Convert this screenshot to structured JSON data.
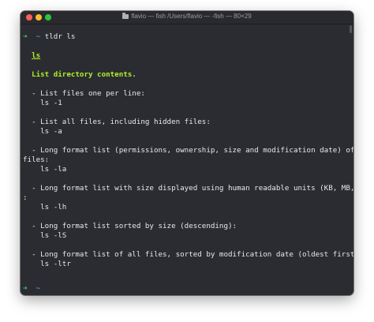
{
  "window": {
    "title": "flavio — fish /Users/flavio — -fish — 80×29"
  },
  "terminal": {
    "prompt_arrow": "➜",
    "prompt_dir": "~",
    "command": "tldr ls",
    "page_name": "ls",
    "summary": "List directory contents.",
    "entries": [
      {
        "desc": "- List files one per line:",
        "code": "ls -1"
      },
      {
        "desc": "- List all files, including hidden files:",
        "code": "ls -a"
      },
      {
        "desc": "- Long format list (permissions, ownership, size and modification date) of all",
        "desc_wrap": "files:",
        "code": "ls -la"
      },
      {
        "desc": "- Long format list with size displayed using human readable units (KB, MB, GB)",
        "desc_wrap": ":",
        "code": "ls -lh"
      },
      {
        "desc": "- Long format list sorted by size (descending):",
        "code": "ls -lS"
      },
      {
        "desc": "- Long format list of all files, sorted by modification date (oldest first):",
        "code": "ls -ltr"
      }
    ],
    "final_prompt_arrow": "➜",
    "final_prompt_dir": "~"
  }
}
